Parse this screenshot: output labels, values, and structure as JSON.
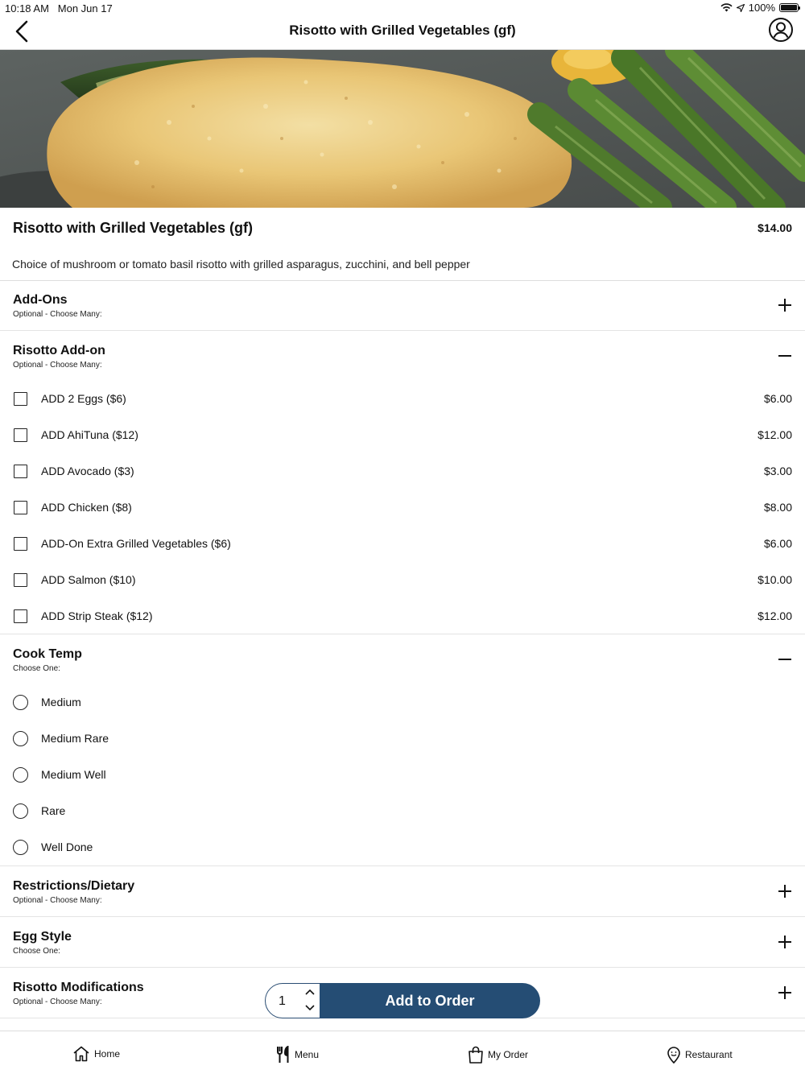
{
  "status_bar": {
    "time": "10:18 AM",
    "date": "Mon Jun 17",
    "battery": "100%",
    "battery_level": 1.0
  },
  "nav": {
    "title": "Risotto with Grilled Vegetables (gf)",
    "back_icon": "chevron-left-icon",
    "profile_icon": "user-circle-icon"
  },
  "item": {
    "name": "Risotto with Grilled Vegetables (gf)",
    "price": "$14.00",
    "description": "Choice of mushroom or tomato basil risotto with grilled asparagus, zucchini, and bell pepper"
  },
  "sections": {
    "addons": {
      "title": "Add-Ons",
      "subtitle": "Optional - Choose Many:",
      "expanded": false
    },
    "risotto_addon": {
      "title": "Risotto Add-on",
      "subtitle": "Optional - Choose Many:",
      "expanded": true,
      "options": [
        {
          "label": "ADD 2 Eggs ($6)",
          "price": "$6.00"
        },
        {
          "label": "ADD AhiTuna ($12)",
          "price": "$12.00"
        },
        {
          "label": "ADD Avocado ($3)",
          "price": "$3.00"
        },
        {
          "label": "ADD Chicken ($8)",
          "price": "$8.00"
        },
        {
          "label": "ADD-On Extra Grilled Vegetables ($6)",
          "price": "$6.00"
        },
        {
          "label": "ADD Salmon ($10)",
          "price": "$10.00"
        },
        {
          "label": "ADD Strip Steak ($12)",
          "price": "$12.00"
        }
      ]
    },
    "cook_temp": {
      "title": "Cook Temp",
      "subtitle": "Choose One:",
      "expanded": true,
      "options": [
        {
          "label": "Medium"
        },
        {
          "label": "Medium Rare"
        },
        {
          "label": "Medium Well"
        },
        {
          "label": "Rare"
        },
        {
          "label": "Well Done"
        }
      ]
    },
    "restrictions": {
      "title": "Restrictions/Dietary",
      "subtitle": "Optional - Choose Many:",
      "expanded": false
    },
    "egg_style": {
      "title": "Egg Style",
      "subtitle": "Choose One:",
      "expanded": false
    },
    "risotto_mods": {
      "title": "Risotto Modifications",
      "subtitle": "Optional - Choose Many:",
      "expanded": false
    }
  },
  "order": {
    "quantity": "1",
    "add_label": "Add to Order",
    "accent": "#254d74"
  },
  "tabs": [
    {
      "label": "Home",
      "icon": "home-icon"
    },
    {
      "label": "Menu",
      "icon": "fork-knife-icon"
    },
    {
      "label": "My Order",
      "icon": "shopping-bag-icon"
    },
    {
      "label": "Restaurant",
      "icon": "location-pin-icon"
    }
  ]
}
